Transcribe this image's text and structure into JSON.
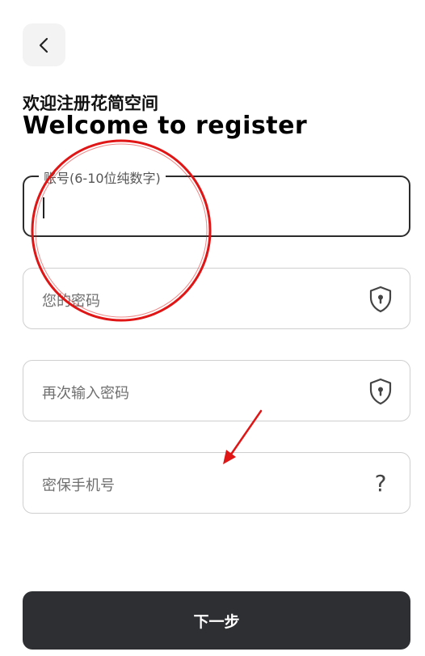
{
  "header": {
    "title_cn": "欢迎注册花简空间",
    "title_en": "Welcome to register"
  },
  "form": {
    "account_label": "账号(6-10位纯数字)",
    "password_placeholder": "您的密码",
    "confirm_placeholder": "再次输入密码",
    "phone_placeholder": "密保手机号",
    "help_glyph": "?"
  },
  "actions": {
    "next_label": "下一步"
  },
  "icons": {
    "back": "chevron-left-icon",
    "password": "shield-lock-icon",
    "confirm": "shield-lock-icon",
    "phone": "question-mark-icon"
  },
  "colors": {
    "button_bg": "#2e2f32",
    "annotation": "#e01515",
    "active_border": "#2b2b2b",
    "border": "#cfcfcf"
  }
}
